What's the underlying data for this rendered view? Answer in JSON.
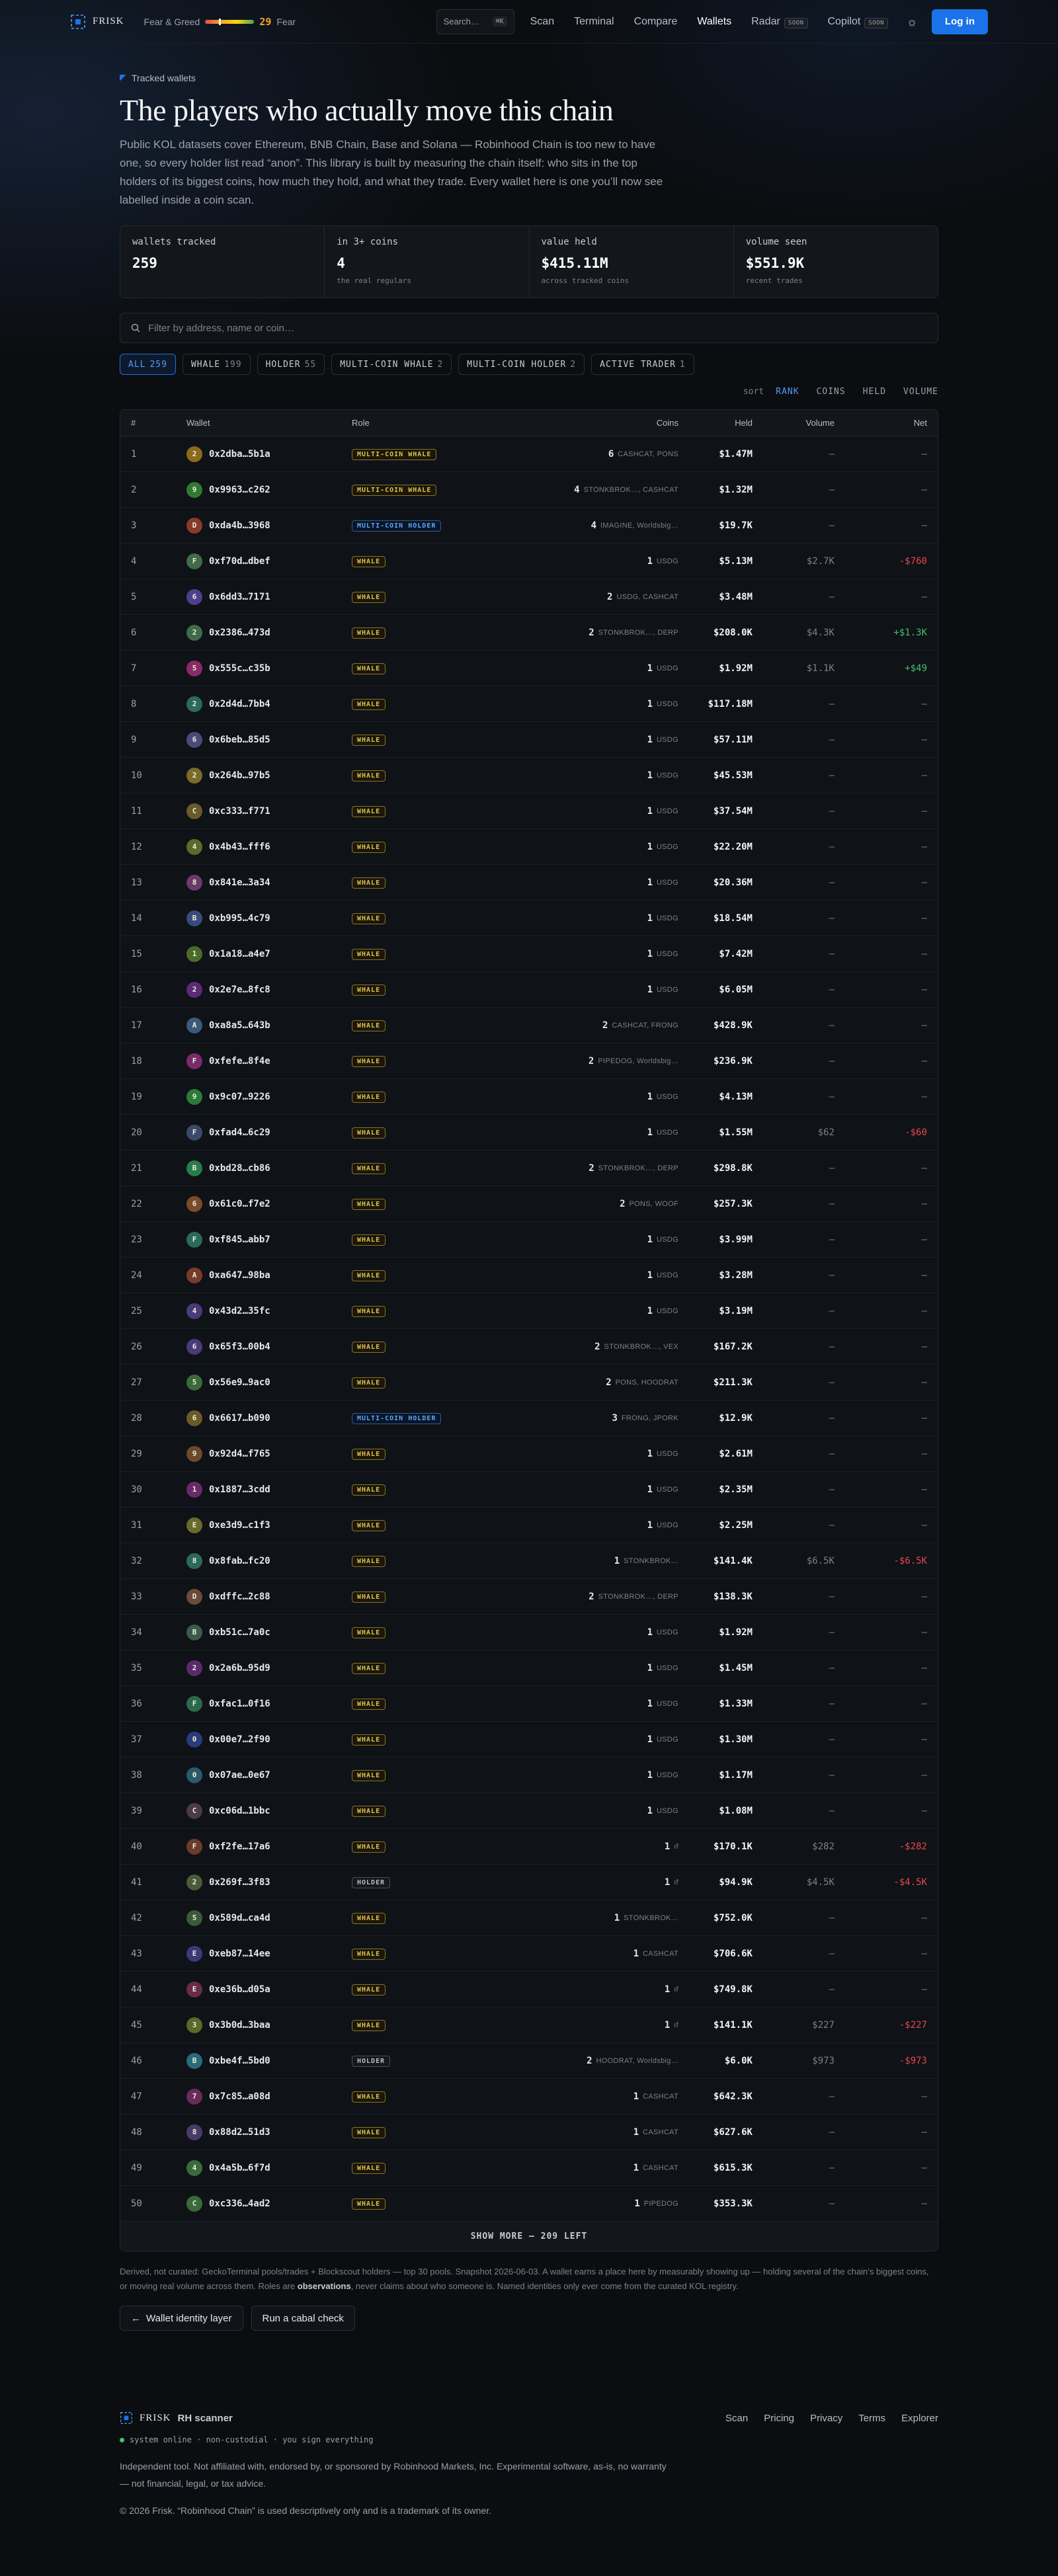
{
  "nav": {
    "brand": "FRISK",
    "fear_greed_label": "Fear & Greed",
    "fear_greed_value": "29",
    "fear_greed_level": 0.29,
    "fear_greed_word": "Fear",
    "search_label": "Search…",
    "search_kbd": "⌘K",
    "links": [
      {
        "label": "Scan",
        "soon": ""
      },
      {
        "label": "Terminal",
        "soon": ""
      },
      {
        "label": "Compare",
        "soon": ""
      },
      {
        "label": "Wallets",
        "soon": ""
      },
      {
        "label": "Radar",
        "soon": "SOON"
      },
      {
        "label": "Copilot",
        "soon": "SOON"
      }
    ],
    "active_link": "Wallets",
    "login_label": "Log in"
  },
  "header": {
    "eyebrow": "Tracked wallets",
    "title": "The players who actually move this chain",
    "lede": "Public KOL datasets cover Ethereum, BNB Chain, Base and Solana — Robinhood Chain is too new to have one, so every holder list read “anon”. This library is built by measuring the chain itself: who sits in the top holders of its biggest coins, how much they hold, and what they trade. Every wallet here is one you’ll now see labelled inside a coin scan."
  },
  "stats": [
    {
      "label": "wallets tracked",
      "value": "259",
      "sub": ""
    },
    {
      "label": "in 3+ coins",
      "value": "4",
      "sub": "the real regulars"
    },
    {
      "label": "value held",
      "value": "$415.11M",
      "sub": "across tracked coins"
    },
    {
      "label": "volume seen",
      "value": "$551.9K",
      "sub": "recent trades"
    }
  ],
  "filter": {
    "placeholder": "Filter by address, name or coin…"
  },
  "chips": [
    {
      "label": "ALL",
      "count": "259"
    },
    {
      "label": "WHALE",
      "count": "199"
    },
    {
      "label": "HOLDER",
      "count": "55"
    },
    {
      "label": "MULTI-COIN WHALE",
      "count": "2"
    },
    {
      "label": "MULTI-COIN HOLDER",
      "count": "2"
    },
    {
      "label": "ACTIVE TRADER",
      "count": "1"
    }
  ],
  "sort": {
    "label": "sort",
    "options": [
      "RANK",
      "COINS",
      "HELD",
      "VOLUME"
    ],
    "active": "RANK"
  },
  "columns": [
    "#",
    "Wallet",
    "Role",
    "Coins",
    "Held",
    "Volume",
    "Net"
  ],
  "rows": [
    {
      "n": "1",
      "letter": "2",
      "color": "#8a6a1c",
      "addr": "0x2dba…5b1a",
      "role": "MULTI-COIN WHALE",
      "rc": "MCW",
      "cnt": "6",
      "coins": "CASHCAT, PONS",
      "held": "$1.47M",
      "vol": "—",
      "net": "—",
      "nc": ""
    },
    {
      "n": "2",
      "letter": "9",
      "color": "#2f7a2f",
      "addr": "0x9963…c262",
      "role": "MULTI-COIN WHALE",
      "rc": "MCW",
      "cnt": "4",
      "coins": "STONKBROK…, CASHCAT",
      "held": "$1.32M",
      "vol": "—",
      "net": "—",
      "nc": ""
    },
    {
      "n": "3",
      "letter": "D",
      "color": "#8a3a2a",
      "addr": "0xda4b…3968",
      "role": "MULTI-COIN HOLDER",
      "rc": "MCH",
      "cnt": "4",
      "coins": "IMAGINE, Worldsbig…",
      "held": "$19.7K",
      "vol": "—",
      "net": "—",
      "nc": ""
    },
    {
      "n": "4",
      "letter": "F",
      "color": "#3f6b4a",
      "addr": "0xf70d…dbef",
      "role": "WHALE",
      "rc": "WHALE",
      "cnt": "1",
      "coins": "USDG",
      "held": "$5.13M",
      "vol": "$2.7K",
      "net": "-$760",
      "nc": "neg"
    },
    {
      "n": "5",
      "letter": "6",
      "color": "#4d3f8a",
      "addr": "0x6dd3…7171",
      "role": "WHALE",
      "rc": "WHALE",
      "cnt": "2",
      "coins": "USDG, CASHCAT",
      "held": "$3.48M",
      "vol": "—",
      "net": "—",
      "nc": ""
    },
    {
      "n": "6",
      "letter": "2",
      "color": "#3f6b4a",
      "addr": "0x2386…473d",
      "role": "WHALE",
      "rc": "WHALE",
      "cnt": "2",
      "coins": "STONKBROK…, DERP",
      "held": "$208.0K",
      "vol": "$4.3K",
      "net": "+$1.3K",
      "nc": "pos"
    },
    {
      "n": "7",
      "letter": "5",
      "color": "#8a2a6a",
      "addr": "0x555c…c35b",
      "role": "WHALE",
      "rc": "WHALE",
      "cnt": "1",
      "coins": "USDG",
      "held": "$1.92M",
      "vol": "$1.1K",
      "net": "+$49",
      "nc": "pos"
    },
    {
      "n": "8",
      "letter": "2",
      "color": "#2a6a5a",
      "addr": "0x2d4d…7bb4",
      "role": "WHALE",
      "rc": "WHALE",
      "cnt": "1",
      "coins": "USDG",
      "held": "$117.18M",
      "vol": "—",
      "net": "—",
      "nc": ""
    },
    {
      "n": "9",
      "letter": "6",
      "color": "#4a4a7a",
      "addr": "0x6beb…85d5",
      "role": "WHALE",
      "rc": "WHALE",
      "cnt": "1",
      "coins": "USDG",
      "held": "$57.11M",
      "vol": "—",
      "net": "—",
      "nc": ""
    },
    {
      "n": "10",
      "letter": "2",
      "color": "#7a6a2a",
      "addr": "0x264b…97b5",
      "role": "WHALE",
      "rc": "WHALE",
      "cnt": "1",
      "coins": "USDG",
      "held": "$45.53M",
      "vol": "—",
      "net": "—",
      "nc": ""
    },
    {
      "n": "11",
      "letter": "C",
      "color": "#6a5a2a",
      "addr": "0xc333…f771",
      "role": "WHALE",
      "rc": "WHALE",
      "cnt": "1",
      "coins": "USDG",
      "held": "$37.54M",
      "vol": "—",
      "net": "—",
      "nc": ""
    },
    {
      "n": "12",
      "letter": "4",
      "color": "#5a6a2a",
      "addr": "0x4b43…fff6",
      "role": "WHALE",
      "rc": "WHALE",
      "cnt": "1",
      "coins": "USDG",
      "held": "$22.20M",
      "vol": "—",
      "net": "—",
      "nc": ""
    },
    {
      "n": "13",
      "letter": "8",
      "color": "#6a3a6a",
      "addr": "0x841e…3a34",
      "role": "WHALE",
      "rc": "WHALE",
      "cnt": "1",
      "coins": "USDG",
      "held": "$20.36M",
      "vol": "—",
      "net": "—",
      "nc": ""
    },
    {
      "n": "14",
      "letter": "B",
      "color": "#3a4a7a",
      "addr": "0xb995…4c79",
      "role": "WHALE",
      "rc": "WHALE",
      "cnt": "1",
      "coins": "USDG",
      "held": "$18.54M",
      "vol": "—",
      "net": "—",
      "nc": ""
    },
    {
      "n": "15",
      "letter": "1",
      "color": "#4a6a2a",
      "addr": "0x1a18…a4e7",
      "role": "WHALE",
      "rc": "WHALE",
      "cnt": "1",
      "coins": "USDG",
      "held": "$7.42M",
      "vol": "—",
      "net": "—",
      "nc": ""
    },
    {
      "n": "16",
      "letter": "2",
      "color": "#5a2a7a",
      "addr": "0x2e7e…8fc8",
      "role": "WHALE",
      "rc": "WHALE",
      "cnt": "1",
      "coins": "USDG",
      "held": "$6.05M",
      "vol": "—",
      "net": "—",
      "nc": ""
    },
    {
      "n": "17",
      "letter": "A",
      "color": "#3a5a7a",
      "addr": "0xa8a5…643b",
      "role": "WHALE",
      "rc": "WHALE",
      "cnt": "2",
      "coins": "CASHCAT, FRONG",
      "held": "$428.9K",
      "vol": "—",
      "net": "—",
      "nc": ""
    },
    {
      "n": "18",
      "letter": "F",
      "color": "#7a2a6a",
      "addr": "0xfefe…8f4e",
      "role": "WHALE",
      "rc": "WHALE",
      "cnt": "2",
      "coins": "PIPEDOG, Worldsbig…",
      "held": "$236.9K",
      "vol": "—",
      "net": "—",
      "nc": ""
    },
    {
      "n": "19",
      "letter": "9",
      "color": "#2a7a3a",
      "addr": "0x9c07…9226",
      "role": "WHALE",
      "rc": "WHALE",
      "cnt": "1",
      "coins": "USDG",
      "held": "$4.13M",
      "vol": "—",
      "net": "—",
      "nc": ""
    },
    {
      "n": "20",
      "letter": "F",
      "color": "#3a4a6a",
      "addr": "0xfad4…6c29",
      "role": "WHALE",
      "rc": "WHALE",
      "cnt": "1",
      "coins": "USDG",
      "held": "$1.55M",
      "vol": "$62",
      "net": "-$60",
      "nc": "neg"
    },
    {
      "n": "21",
      "letter": "B",
      "color": "#2a7a4a",
      "addr": "0xbd28…cb86",
      "role": "WHALE",
      "rc": "WHALE",
      "cnt": "2",
      "coins": "STONKBROK…, DERP",
      "held": "$298.8K",
      "vol": "—",
      "net": "—",
      "nc": ""
    },
    {
      "n": "22",
      "letter": "6",
      "color": "#7a4a2a",
      "addr": "0x61c0…f7e2",
      "role": "WHALE",
      "rc": "WHALE",
      "cnt": "2",
      "coins": "PONS, WOOF",
      "held": "$257.3K",
      "vol": "—",
      "net": "—",
      "nc": ""
    },
    {
      "n": "23",
      "letter": "F",
      "color": "#2a6a5a",
      "addr": "0xf845…abb7",
      "role": "WHALE",
      "rc": "WHALE",
      "cnt": "1",
      "coins": "USDG",
      "held": "$3.99M",
      "vol": "—",
      "net": "—",
      "nc": ""
    },
    {
      "n": "24",
      "letter": "A",
      "color": "#7a3a2a",
      "addr": "0xa647…98ba",
      "role": "WHALE",
      "rc": "WHALE",
      "cnt": "1",
      "coins": "USDG",
      "held": "$3.28M",
      "vol": "—",
      "net": "—",
      "nc": ""
    },
    {
      "n": "25",
      "letter": "4",
      "color": "#4a3a7a",
      "addr": "0x43d2…35fc",
      "role": "WHALE",
      "rc": "WHALE",
      "cnt": "1",
      "coins": "USDG",
      "held": "$3.19M",
      "vol": "—",
      "net": "—",
      "nc": ""
    },
    {
      "n": "26",
      "letter": "6",
      "color": "#4a3a7a",
      "addr": "0x65f3…00b4",
      "role": "WHALE",
      "rc": "WHALE",
      "cnt": "2",
      "coins": "STONKBROK…, VEX",
      "held": "$167.2K",
      "vol": "—",
      "net": "—",
      "nc": ""
    },
    {
      "n": "27",
      "letter": "5",
      "color": "#3a6a3a",
      "addr": "0x56e9…9ac0",
      "role": "WHALE",
      "rc": "WHALE",
      "cnt": "2",
      "coins": "PONS, HOODRAT",
      "held": "$211.3K",
      "vol": "—",
      "net": "—",
      "nc": ""
    },
    {
      "n": "28",
      "letter": "6",
      "color": "#6a5a2a",
      "addr": "0x6617…b090",
      "role": "MULTI-COIN HOLDER",
      "rc": "MCH",
      "cnt": "3",
      "coins": "FRONG, JPORK",
      "held": "$12.9K",
      "vol": "—",
      "net": "—",
      "nc": ""
    },
    {
      "n": "29",
      "letter": "9",
      "color": "#6a4a2a",
      "addr": "0x92d4…f765",
      "role": "WHALE",
      "rc": "WHALE",
      "cnt": "1",
      "coins": "USDG",
      "held": "$2.61M",
      "vol": "—",
      "net": "—",
      "nc": ""
    },
    {
      "n": "30",
      "letter": "1",
      "color": "#6a2a6a",
      "addr": "0x1887…3cdd",
      "role": "WHALE",
      "rc": "WHALE",
      "cnt": "1",
      "coins": "USDG",
      "held": "$2.35M",
      "vol": "—",
      "net": "—",
      "nc": ""
    },
    {
      "n": "31",
      "letter": "E",
      "color": "#6a6a2a",
      "addr": "0xe3d9…c1f3",
      "role": "WHALE",
      "rc": "WHALE",
      "cnt": "1",
      "coins": "USDG",
      "held": "$2.25M",
      "vol": "—",
      "net": "—",
      "nc": ""
    },
    {
      "n": "32",
      "letter": "8",
      "color": "#2a6a5a",
      "addr": "0x8fab…fc20",
      "role": "WHALE",
      "rc": "WHALE",
      "cnt": "1",
      "coins": "STONKBROK…",
      "held": "$141.4K",
      "vol": "$6.5K",
      "net": "-$6.5K",
      "nc": "neg"
    },
    {
      "n": "33",
      "letter": "D",
      "color": "#6a4a3a",
      "addr": "0xdffc…2c88",
      "role": "WHALE",
      "rc": "WHALE",
      "cnt": "2",
      "coins": "STONKBROK…, DERP",
      "held": "$138.3K",
      "vol": "—",
      "net": "—",
      "nc": ""
    },
    {
      "n": "34",
      "letter": "B",
      "color": "#3a5a4a",
      "addr": "0xb51c…7a0c",
      "role": "WHALE",
      "rc": "WHALE",
      "cnt": "1",
      "coins": "USDG",
      "held": "$1.92M",
      "vol": "—",
      "net": "—",
      "nc": ""
    },
    {
      "n": "35",
      "letter": "2",
      "color": "#5a2a6a",
      "addr": "0x2a6b…95d9",
      "role": "WHALE",
      "rc": "WHALE",
      "cnt": "1",
      "coins": "USDG",
      "held": "$1.45M",
      "vol": "—",
      "net": "—",
      "nc": ""
    },
    {
      "n": "36",
      "letter": "F",
      "color": "#2a6a4a",
      "addr": "0xfac1…0f16",
      "role": "WHALE",
      "rc": "WHALE",
      "cnt": "1",
      "coins": "USDG",
      "held": "$1.33M",
      "vol": "—",
      "net": "—",
      "nc": ""
    },
    {
      "n": "37",
      "letter": "0",
      "color": "#2a3a7a",
      "addr": "0x00e7…2f90",
      "role": "WHALE",
      "rc": "WHALE",
      "cnt": "1",
      "coins": "USDG",
      "held": "$1.30M",
      "vol": "—",
      "net": "—",
      "nc": ""
    },
    {
      "n": "38",
      "letter": "0",
      "color": "#2a5a6a",
      "addr": "0x07ae…0e67",
      "role": "WHALE",
      "rc": "WHALE",
      "cnt": "1",
      "coins": "USDG",
      "held": "$1.17M",
      "vol": "—",
      "net": "—",
      "nc": ""
    },
    {
      "n": "39",
      "letter": "C",
      "color": "#4a3a4a",
      "addr": "0xc06d…1bbc",
      "role": "WHALE",
      "rc": "WHALE",
      "cnt": "1",
      "coins": "USDG",
      "held": "$1.08M",
      "vol": "—",
      "net": "—",
      "nc": ""
    },
    {
      "n": "40",
      "letter": "F",
      "color": "#6a3a2a",
      "addr": "0xf2fe…17a6",
      "role": "WHALE",
      "rc": "WHALE",
      "cnt": "1",
      "coins": "ıf",
      "held": "$170.1K",
      "vol": "$282",
      "net": "-$282",
      "nc": "neg"
    },
    {
      "n": "41",
      "letter": "2",
      "color": "#4a5a3a",
      "addr": "0x269f…3f83",
      "role": "HOLDER",
      "rc": "HOLDER",
      "cnt": "1",
      "coins": "ıf",
      "held": "$94.9K",
      "vol": "$4.5K",
      "net": "-$4.5K",
      "nc": "neg"
    },
    {
      "n": "42",
      "letter": "5",
      "color": "#3a5a3a",
      "addr": "0x589d…ca4d",
      "role": "WHALE",
      "rc": "WHALE",
      "cnt": "1",
      "coins": "STONKBROK…",
      "held": "$752.0K",
      "vol": "—",
      "net": "—",
      "nc": ""
    },
    {
      "n": "43",
      "letter": "E",
      "color": "#3a3a7a",
      "addr": "0xeb87…14ee",
      "role": "WHALE",
      "rc": "WHALE",
      "cnt": "1",
      "coins": "CASHCAT",
      "held": "$706.6K",
      "vol": "—",
      "net": "—",
      "nc": ""
    },
    {
      "n": "44",
      "letter": "E",
      "color": "#6a2a4a",
      "addr": "0xe36b…d05a",
      "role": "WHALE",
      "rc": "WHALE",
      "cnt": "1",
      "coins": "ıf",
      "held": "$749.8K",
      "vol": "—",
      "net": "—",
      "nc": ""
    },
    {
      "n": "45",
      "letter": "3",
      "color": "#5a6a2a",
      "addr": "0x3b0d…3baa",
      "role": "WHALE",
      "rc": "WHALE",
      "cnt": "1",
      "coins": "ıf",
      "held": "$141.1K",
      "vol": "$227",
      "net": "-$227",
      "nc": "neg"
    },
    {
      "n": "46",
      "letter": "B",
      "color": "#2a6a7a",
      "addr": "0xbe4f…5bd0",
      "role": "HOLDER",
      "rc": "HOLDER",
      "cnt": "2",
      "coins": "HOODRAT, Worldsbig…",
      "held": "$6.0K",
      "vol": "$973",
      "net": "-$973",
      "nc": "neg"
    },
    {
      "n": "47",
      "letter": "7",
      "color": "#6a2a5a",
      "addr": "0x7c85…a08d",
      "role": "WHALE",
      "rc": "WHALE",
      "cnt": "1",
      "coins": "CASHCAT",
      "held": "$642.3K",
      "vol": "—",
      "net": "—",
      "nc": ""
    },
    {
      "n": "48",
      "letter": "8",
      "color": "#4a3a6a",
      "addr": "0x88d2…51d3",
      "role": "WHALE",
      "rc": "WHALE",
      "cnt": "1",
      "coins": "CASHCAT",
      "held": "$627.6K",
      "vol": "—",
      "net": "—",
      "nc": ""
    },
    {
      "n": "49",
      "letter": "4",
      "color": "#3a6a3a",
      "addr": "0x4a5b…6f7d",
      "role": "WHALE",
      "rc": "WHALE",
      "cnt": "1",
      "coins": "CASHCAT",
      "held": "$615.3K",
      "vol": "—",
      "net": "—",
      "nc": ""
    },
    {
      "n": "50",
      "letter": "C",
      "color": "#3a6a3a",
      "addr": "0xc336…4ad2",
      "role": "WHALE",
      "rc": "WHALE",
      "cnt": "1",
      "coins": "PIPEDOG",
      "held": "$353.3K",
      "vol": "—",
      "net": "—",
      "nc": ""
    }
  ],
  "show_more": "SHOW MORE — 209 LEFT",
  "note_pre": "Derived, not curated: GeckoTerminal pools/trades + Blockscout holders — top 30 pools. Snapshot 2026-06-03. A wallet earns a place here by measurably showing up — holding several of the chain’s biggest coins, or moving real volume across them. Roles are ",
  "note_bold": "observations",
  "note_post": ", never claims about who someone is. Named identities only ever come from the curated KOL registry.",
  "buttons": {
    "identity": "Wallet identity layer",
    "cabal": "Run a cabal check"
  },
  "footer": {
    "brand": "FRISK",
    "tag": "RH scanner",
    "links": [
      "Scan",
      "Pricing",
      "Privacy",
      "Terms",
      "Explorer"
    ],
    "status": "system online · non-custodial · you sign everything",
    "disclaimer": "Independent tool. Not affiliated with, endorsed by, or sponsored by Robinhood Markets, Inc. Experimental software, as-is, no warranty — not financial, legal, or tax advice.",
    "copyright": "© 2026 Frisk. “Robinhood Chain” is used descriptively only and is a trademark of its owner."
  },
  "colors": {
    "accent": "#1a73e8",
    "whale": "#e2c14a",
    "holder_multi": "#5aa6ff",
    "negative": "#e5484d",
    "positive": "#46c06b"
  }
}
